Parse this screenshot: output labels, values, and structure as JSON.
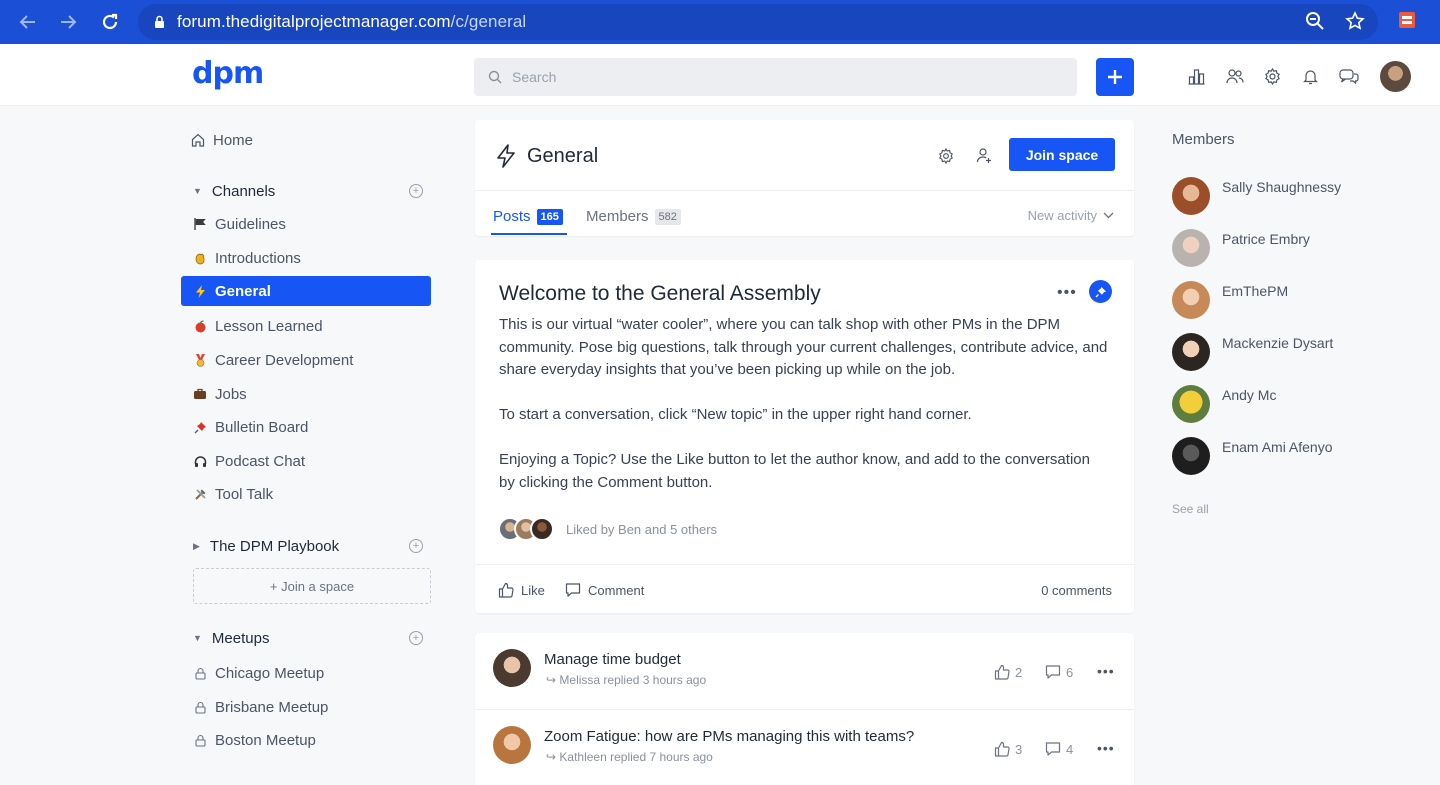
{
  "browser": {
    "url_domain": "forum.thedigitalprojectmanager.com",
    "url_path": "/c/general"
  },
  "header": {
    "logo": "dpm",
    "search_placeholder": "Search"
  },
  "sidebar": {
    "home_label": "Home",
    "channels_label": "Channels",
    "channels": [
      {
        "label": "Guidelines",
        "icon": "flag-icon"
      },
      {
        "label": "Introductions",
        "icon": "wave-icon"
      },
      {
        "label": "General",
        "icon": "bolt-icon",
        "active": true
      },
      {
        "label": "Lesson Learned",
        "icon": "apple-icon"
      },
      {
        "label": "Career Development",
        "icon": "medal-icon"
      },
      {
        "label": "Jobs",
        "icon": "briefcase-icon"
      },
      {
        "label": "Bulletin Board",
        "icon": "pushpin-icon"
      },
      {
        "label": "Podcast Chat",
        "icon": "headphones-icon"
      },
      {
        "label": "Tool Talk",
        "icon": "tools-icon"
      }
    ],
    "playbook_label": "The DPM Playbook",
    "join_space_label": "+ Join a space",
    "meetups_label": "Meetups",
    "meetups": [
      {
        "label": "Chicago Meetup"
      },
      {
        "label": "Brisbane Meetup"
      },
      {
        "label": "Boston Meetup"
      }
    ]
  },
  "space": {
    "title": "General",
    "join_label": "Join space",
    "tabs": [
      {
        "label": "Posts",
        "count": "165"
      },
      {
        "label": "Members",
        "count": "582"
      }
    ],
    "sort_label": "New activity"
  },
  "pinned_post": {
    "title": "Welcome to the General Assembly",
    "paragraphs": [
      "This is our virtual “water cooler”, where you can talk shop with other PMs in the DPM community. Pose big questions, talk through your current challenges, contribute advice, and share everyday insights that you’ve been picking up while on the job.",
      "To start a conversation, click “New topic” in the upper right hand corner.",
      "Enjoying a Topic? Use the Like button to let the author know, and add to the conversation by clicking the Comment button."
    ],
    "liked_by": "Liked by Ben and 5 others",
    "like_label": "Like",
    "comment_label": "Comment",
    "comments_count": "0 comments"
  },
  "topics": [
    {
      "title": "Manage time budget",
      "sub": "Melissa replied 3 hours ago",
      "likes": "2",
      "comments": "6"
    },
    {
      "title": "Zoom Fatigue: how are PMs managing this with teams?",
      "sub": "Kathleen replied 7 hours ago",
      "likes": "3",
      "comments": "4"
    }
  ],
  "members": {
    "heading": "Members",
    "list": [
      {
        "name": "Sally Shaughnessy"
      },
      {
        "name": "Patrice Embry"
      },
      {
        "name": "EmThePM"
      },
      {
        "name": "Mackenzie Dysart"
      },
      {
        "name": "Andy Mc"
      },
      {
        "name": "Enam Ami Afenyo"
      }
    ],
    "see_all": "See all"
  },
  "colors": {
    "accent": "#1756f5",
    "browser_bar": "#1a4fd6"
  }
}
